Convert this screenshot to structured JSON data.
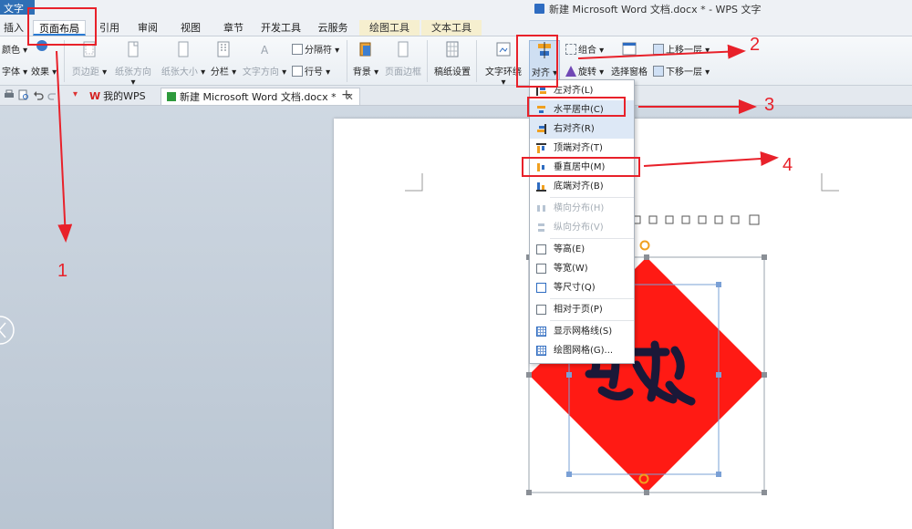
{
  "app": {
    "badge": "文字"
  },
  "window": {
    "title": "新建 Microsoft Word 文档.docx * - WPS 文字"
  },
  "tabs": [
    {
      "label": "插入"
    },
    {
      "label": "页面布局"
    },
    {
      "label": "引用"
    },
    {
      "label": "审阅"
    },
    {
      "label": "视图"
    },
    {
      "label": "章节"
    },
    {
      "label": "开发工具"
    },
    {
      "label": "云服务"
    },
    {
      "label": "绘图工具"
    },
    {
      "label": "文本工具"
    }
  ],
  "ribbon": {
    "color": "颜色",
    "font": "字体",
    "effect": "效果",
    "margins": "页边距",
    "orientation": "纸张方向",
    "size": "纸张大小",
    "columns": "分栏",
    "text_direction": "文字方向",
    "separator": "分隔符",
    "line_numbers": "行号",
    "background": "背景",
    "page_border": "页面边框",
    "paper_setup": "稿纸设置",
    "wrap": "文字环绕",
    "align": "对齐",
    "group": "组合",
    "rotate": "旋转",
    "selection_pane": "选择窗格",
    "bring_forward": "上移一层",
    "send_backward": "下移一层"
  },
  "doc_tabs": [
    {
      "label": "我的WPS"
    },
    {
      "label": "新建 Microsoft Word 文档.docx *"
    }
  ],
  "menu": [
    {
      "label": "左对齐(L)"
    },
    {
      "label": "水平居中(C)"
    },
    {
      "label": "右对齐(R)"
    },
    {
      "label": "顶端对齐(T)"
    },
    {
      "label": "垂直居中(M)"
    },
    {
      "label": "底端对齐(B)"
    },
    {
      "label": "横向分布(H)"
    },
    {
      "label": "纵向分布(V)"
    },
    {
      "label": "等高(E)"
    },
    {
      "label": "等宽(W)"
    },
    {
      "label": "等尺寸(Q)"
    },
    {
      "label": "相对于页(P)"
    },
    {
      "label": "显示网格线(S)"
    },
    {
      "label": "绘图网格(G)..."
    }
  ],
  "annotations": [
    "1",
    "2",
    "3",
    "4"
  ],
  "picture": {
    "character": "福"
  },
  "colors": {
    "accent": "#2a7ad3",
    "annotation": "#e8212a",
    "fu_red": "#ff1a14"
  }
}
